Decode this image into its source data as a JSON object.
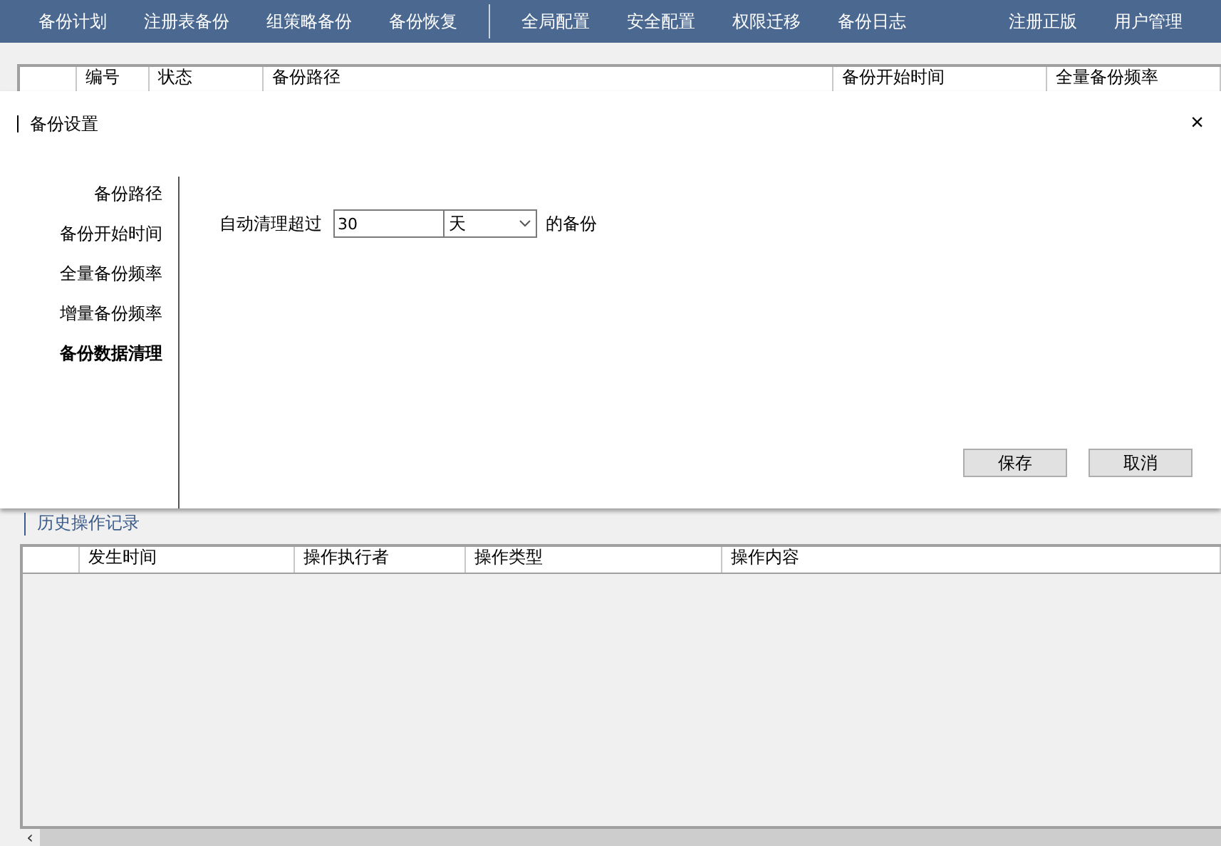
{
  "nav": {
    "groups": [
      [
        "备份计划",
        "注册表备份",
        "组策略备份",
        "备份恢复"
      ],
      [
        "全局配置",
        "安全配置",
        "权限迁移",
        "备份日志"
      ]
    ],
    "right": [
      "注册正版",
      "用户管理"
    ]
  },
  "plan_table": {
    "columns": [
      "",
      "编号",
      "状态",
      "备份路径",
      "备份开始时间",
      "全量备份频率"
    ]
  },
  "history": {
    "title": "历史操作记录",
    "columns": [
      "",
      "发生时间",
      "操作执行者",
      "操作类型",
      "操作内容"
    ]
  },
  "dialog": {
    "title": "备份设置",
    "close": "×",
    "sections": [
      {
        "label": "备份路径",
        "selected": false
      },
      {
        "label": "备份开始时间",
        "selected": false
      },
      {
        "label": "全量备份频率",
        "selected": false
      },
      {
        "label": "增量备份频率",
        "selected": false
      },
      {
        "label": "备份数据清理",
        "selected": true
      }
    ],
    "form": {
      "prefix": "自动清理超过",
      "value": "30",
      "unit": "天",
      "suffix": "的备份"
    },
    "buttons": [
      "保存",
      "取消"
    ]
  },
  "scrollbar": {
    "left_arrow": "‹"
  }
}
